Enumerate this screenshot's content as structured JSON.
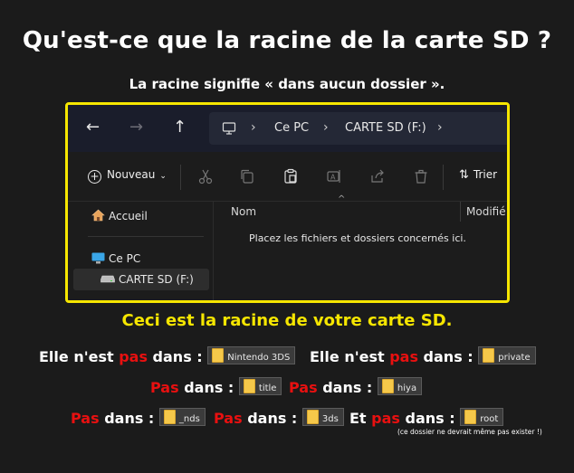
{
  "title": "Qu'est-ce que la racine de la carte SD ?",
  "subtitle": "La racine signifie « dans aucun dossier ».",
  "explorer": {
    "breadcrumb": [
      "Ce PC",
      "CARTE SD (F:)"
    ],
    "new_label": "Nouveau",
    "sort_label": "Trier",
    "sidebar": {
      "home": "Accueil",
      "pc": "Ce PC",
      "sd": "CARTE SD (F:)"
    },
    "columns": {
      "name": "Nom",
      "modified": "Modifié"
    },
    "empty_message": "Placez les fichiers et dossiers concernés ici.",
    "accent_color": "#f6e600"
  },
  "root_text": "Ceci est la racine de votre carte SD.",
  "lines": {
    "elle_nest": "Elle n'est ",
    "pas": "pas",
    "pas_cap": "Pas",
    "dans": " dans : ",
    "et": "Et ",
    "folders": {
      "nintendo3ds": "Nintendo 3DS",
      "private": "private",
      "title": "title",
      "hiya": "hiya",
      "nds": "_nds",
      "3ds": "3ds",
      "root": "root"
    }
  },
  "note": "(ce dossier ne devrait même pas exister !)",
  "colors": {
    "highlight_red": "#e81010",
    "yellow": "#f6e600",
    "folder_icon": "#f5c84a"
  }
}
